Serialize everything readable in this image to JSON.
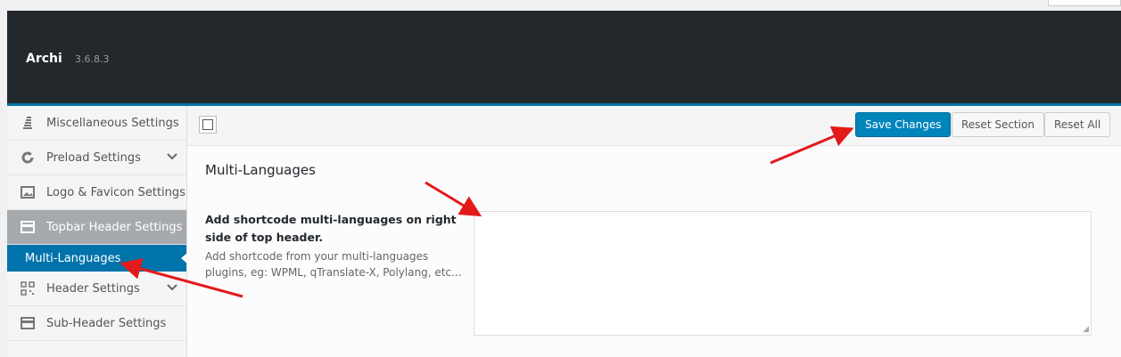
{
  "header": {
    "title": "Archi",
    "version": "3.6.8.3"
  },
  "sidebar": {
    "items": [
      {
        "label": "Miscellaneous Settings",
        "icon": "stack-icon"
      },
      {
        "label": "Preload Settings",
        "icon": "refresh-icon",
        "has_submenu": true
      },
      {
        "label": "Logo & Favicon Settings",
        "icon": "image-icon"
      },
      {
        "label": "Topbar Header Settings",
        "icon": "card-icon",
        "active": true
      },
      {
        "label": "Header Settings",
        "icon": "qrcode-icon",
        "has_submenu": true
      },
      {
        "label": "Sub-Header Settings",
        "icon": "card-icon"
      }
    ],
    "sub_item": {
      "label": "Multi-Languages"
    }
  },
  "toolbar": {
    "save_label": "Save Changes",
    "reset_section_label": "Reset Section",
    "reset_all_label": "Reset All"
  },
  "section": {
    "title": "Multi-Languages",
    "field_label": "Add shortcode multi-languages on right side of top header.",
    "field_desc": "Add shortcode from your multi-languages plugins, eg: WPML, qTranslate-X, Polylang, etc...",
    "field_value": ""
  },
  "colors": {
    "accent": "#0073aa",
    "header_bg": "#23282d",
    "arrow": "#e21a1a"
  }
}
